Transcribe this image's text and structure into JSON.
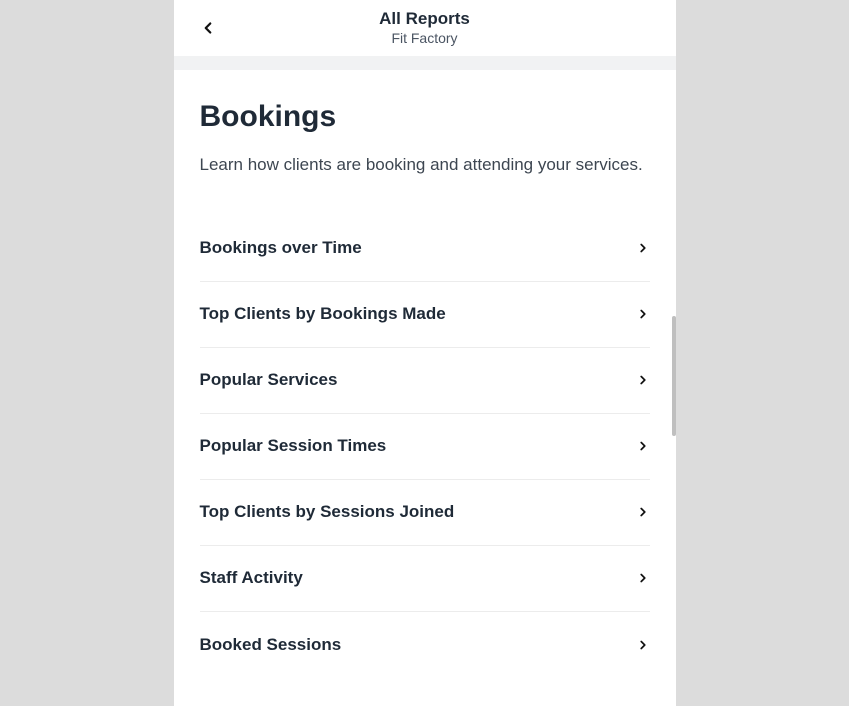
{
  "header": {
    "title": "All Reports",
    "subtitle": "Fit Factory"
  },
  "section": {
    "title": "Bookings",
    "description": "Learn how clients are booking and attending your services."
  },
  "reports": [
    {
      "label": "Bookings over Time"
    },
    {
      "label": "Top Clients by Bookings Made"
    },
    {
      "label": "Popular Services"
    },
    {
      "label": "Popular Session Times"
    },
    {
      "label": "Top Clients by Sessions Joined"
    },
    {
      "label": "Staff Activity"
    },
    {
      "label": "Booked Sessions"
    }
  ]
}
